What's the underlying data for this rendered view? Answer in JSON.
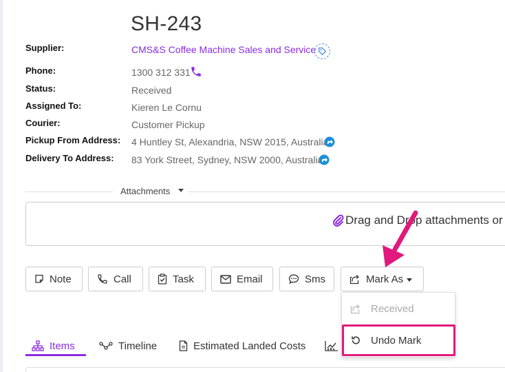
{
  "record": {
    "title": "SH-243"
  },
  "fields": [
    {
      "label": "Supplier:",
      "value": "CMS&S Coffee Machine Sales and Service"
    },
    {
      "label": "Phone:",
      "value": "1300 312 331"
    },
    {
      "label": "Status:",
      "value": "Received"
    },
    {
      "label": "Assigned To:",
      "value": "Kieren Le Cornu"
    },
    {
      "label": "Courier:",
      "value": "Customer Pickup"
    },
    {
      "label": "Pickup From Address:",
      "value": "4 Huntley St, Alexandria, NSW 2015, Australia"
    },
    {
      "label": "Delivery To Address:",
      "value": "83 York Street, Sydney, NSW 2000, Australia"
    }
  ],
  "attachments": {
    "label": "Attachments",
    "drop_text": "Drag and Drop attachments or"
  },
  "actions": {
    "note": "Note",
    "call": "Call",
    "task": "Task",
    "email": "Email",
    "sms": "Sms",
    "mark_as": "Mark As"
  },
  "mark_menu": {
    "items": [
      {
        "label": "Received",
        "disabled": true
      },
      {
        "label": "Undo Mark",
        "disabled": false
      }
    ]
  },
  "tabs": [
    {
      "label": "Items",
      "active": true
    },
    {
      "label": "Timeline",
      "active": false
    },
    {
      "label": "Estimated Landed Costs",
      "active": false
    }
  ],
  "colors": {
    "accent": "#8a2be2",
    "highlight": "#e0197d",
    "nav_icon": "#1e90d6"
  }
}
